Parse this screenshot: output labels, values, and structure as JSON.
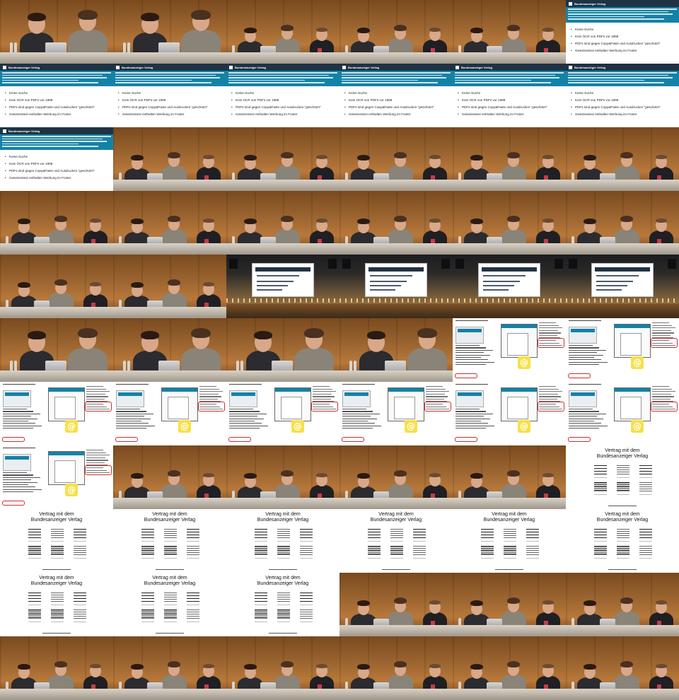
{
  "grid": {
    "columns": 6,
    "rows": 11
  },
  "website_slide": {
    "brand": "Bundesanzeiger Verlag",
    "bullets": [
      "Keine Suche",
      "Kein OCR von PDFs vor 1998",
      "PDFs sind gegen Copy&Paste und Ausdrucken \"geschützt\"",
      "Gesetzestext enthalten Werbung im Footer"
    ]
  },
  "contract_slide": {
    "title_line1": "Vertrag mit dem",
    "title_line2": "Bundesanzeiger Verlag"
  },
  "tile_types": [
    "stage-close",
    "stage-close",
    "stage-wide",
    "stage-wide",
    "stage-wide",
    "website",
    "website",
    "website",
    "website",
    "website",
    "website",
    "website",
    "website",
    "stage-wide",
    "stage-wide",
    "stage-wide",
    "stage-wide",
    "stage-wide",
    "stage-wide",
    "stage-wide",
    "stage-wide",
    "stage-wide",
    "stage-wide",
    "stage-wide",
    "stage-wide",
    "stage-wide",
    "auditorium",
    "auditorium",
    "auditorium",
    "auditorium",
    "stage-close",
    "stage-close",
    "stage-close",
    "stage-close",
    "pdf",
    "pdf",
    "pdf",
    "pdf",
    "pdf",
    "pdf",
    "pdf",
    "pdf",
    "pdf",
    "stage-wide",
    "stage-wide",
    "stage-wide",
    "stage-wide",
    "contract",
    "contract",
    "contract",
    "contract",
    "contract",
    "contract",
    "contract",
    "contract",
    "contract",
    "contract",
    "stage-wide",
    "stage-wide",
    "stage-wide",
    "stage-wide",
    "stage-wide",
    "stage-wide",
    "stage-wide",
    "stage-wide",
    "stage-wide"
  ],
  "colors": {
    "wood": "#9a6430",
    "site_header": "#1f3344",
    "site_banner": "#1482a6",
    "highlight_red": "#d32a2a",
    "at_icon": "#f5e14a"
  }
}
